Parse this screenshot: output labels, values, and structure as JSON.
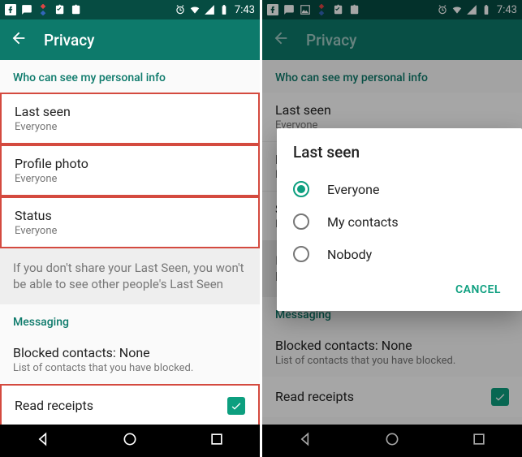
{
  "statusbar": {
    "time": "7:43"
  },
  "appbar": {
    "title": "Privacy"
  },
  "sections": {
    "personal_header": "Who can see my personal info",
    "messaging_header": "Messaging"
  },
  "items": {
    "last_seen": {
      "title": "Last seen",
      "value": "Everyone"
    },
    "profile_photo": {
      "title": "Profile photo",
      "value": "Everyone"
    },
    "status": {
      "title": "Status",
      "value": "Everyone"
    }
  },
  "note": "If you don't share your Last Seen, you won't be able to see other people's Last Seen",
  "blocked": {
    "title": "Blocked contacts: None",
    "subtitle": "List of contacts that you have blocked."
  },
  "receipts": {
    "title": "Read receipts",
    "checked": true
  },
  "dialog": {
    "title": "Last seen",
    "options": [
      "Everyone",
      "My contacts",
      "Nobody"
    ],
    "selected_index": 0,
    "cancel": "CANCEL"
  }
}
